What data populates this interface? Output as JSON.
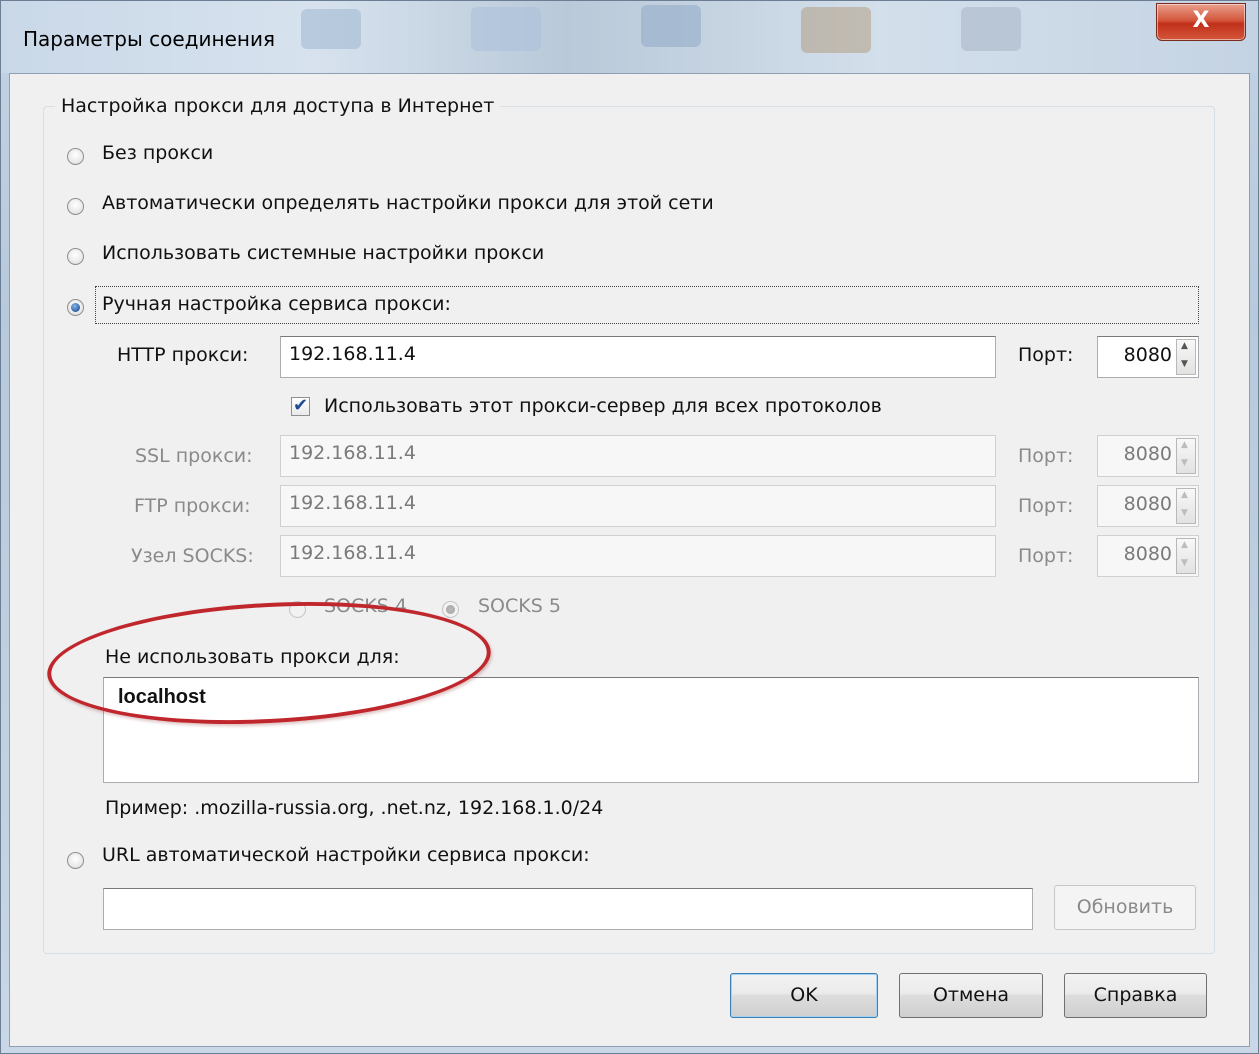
{
  "window": {
    "title": "Параметры соединения",
    "close_label": "X"
  },
  "group": {
    "legend": "Настройка прокси для доступа в Интернет"
  },
  "proxy_modes": [
    {
      "label": "Без прокси",
      "checked": false
    },
    {
      "label": "Автоматически определять настройки прокси для этой сети",
      "checked": false
    },
    {
      "label": "Использовать системные настройки прокси",
      "checked": false
    },
    {
      "label": "Ручная настройка сервиса прокси:",
      "checked": true
    }
  ],
  "http": {
    "label": "HTTP прокси:",
    "value": "192.168.11.4",
    "port_label": "Порт:",
    "port": "8080"
  },
  "use_for_all": {
    "label": "Использовать этот прокси-сервер для всех протоколов",
    "checked": true
  },
  "ssl": {
    "label": "SSL прокси:",
    "value": "192.168.11.4",
    "port_label": "Порт:",
    "port": "8080"
  },
  "ftp": {
    "label": "FTP прокси:",
    "value": "192.168.11.4",
    "port_label": "Порт:",
    "port": "8080"
  },
  "socks": {
    "label": "Узел SOCKS:",
    "value": "192.168.11.4",
    "port_label": "Порт:",
    "port": "8080"
  },
  "socks_versions": [
    {
      "label": "SOCKS 4",
      "checked": false
    },
    {
      "label": "SOCKS 5",
      "checked": true
    }
  ],
  "no_proxy": {
    "label": "Не использовать прокси для:",
    "value": "localhost",
    "example": "Пример: .mozilla-russia.org, .net.nz, 192.168.1.0/24"
  },
  "auto_url": {
    "label": "URL автоматической настройки сервиса прокси:",
    "value": "",
    "reload_label": "Обновить"
  },
  "buttons": {
    "ok": "OK",
    "cancel": "Отмена",
    "help": "Справка"
  },
  "colors": {
    "highlight_ellipse": "#c0272d",
    "radio_checked": "#2a5ea8"
  }
}
